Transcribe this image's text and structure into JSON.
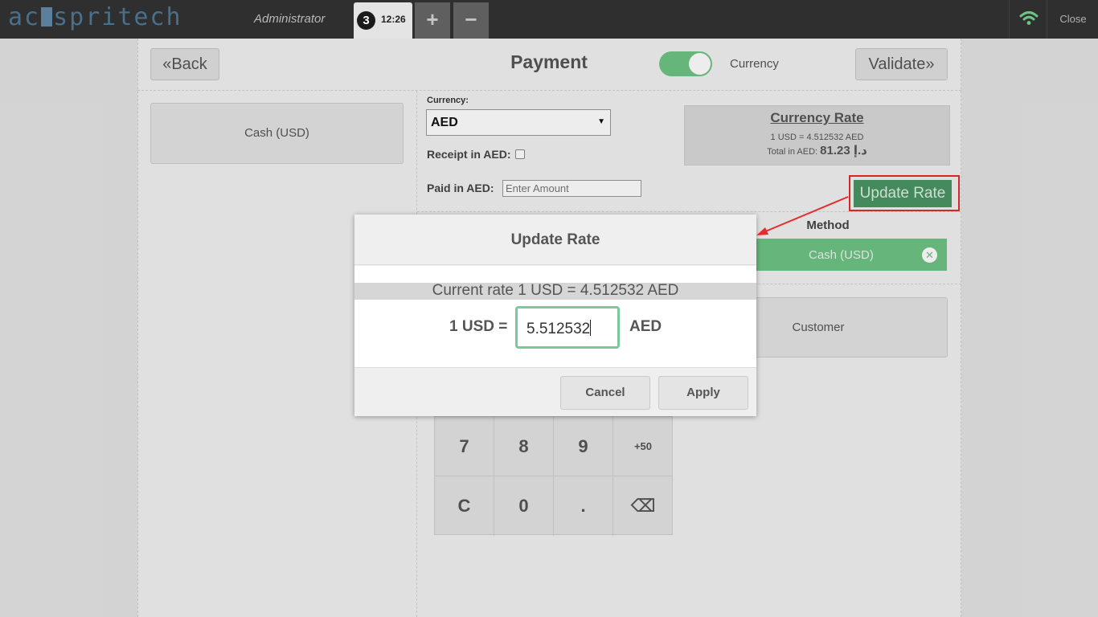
{
  "topbar": {
    "logo_text_a": "ac",
    "logo_text_b": "spritech",
    "user": "Administrator",
    "order_number": "3",
    "order_time": "12:26",
    "add_order": "+",
    "remove_order": "−",
    "close": "Close"
  },
  "payment": {
    "back_label": "Back",
    "title": "Payment",
    "toggle_label": "Currency",
    "validate_label": "Validate",
    "payment_methods": [
      "Cash (USD)"
    ],
    "currency_field_label": "Currency:",
    "currency_selected": "AED",
    "receipt_label": "Receipt in AED:",
    "paid_label": "Paid in AED:",
    "paid_placeholder": "Enter Amount",
    "rate_box": {
      "title": "Currency Rate",
      "rate_line": "1 USD = 4.512532 AED",
      "total_prefix": "Total in AED:",
      "total_value": "81.23 د.إ"
    },
    "update_rate_label": "Update Rate",
    "method_header": "Method",
    "paymentline_method": "Cash (USD)",
    "customer_label": "Customer",
    "numpad_keys": [
      "7",
      "8",
      "9",
      "+50",
      "C",
      "0",
      ".",
      "⌫"
    ]
  },
  "modal": {
    "title": "Update Rate",
    "current_rate": "Current rate 1 USD = 4.512532 AED",
    "left_label": "1 USD =",
    "input_value": "5.512532",
    "right_label": "AED",
    "cancel_label": "Cancel",
    "apply_label": "Apply"
  },
  "colors": {
    "topbar": "#2f2f2f",
    "accent_green": "#6ec384",
    "update_rate_button": "#4b9563",
    "annotation_red": "#e52b2b"
  }
}
